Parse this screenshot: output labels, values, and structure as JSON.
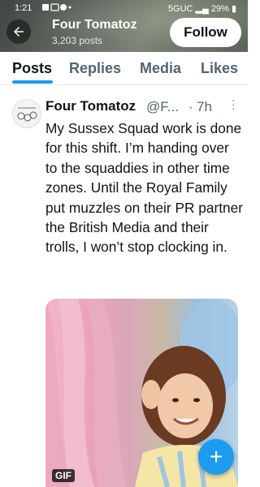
{
  "status_bar": {
    "time": "1:21",
    "network": "5GUC",
    "battery": "29%"
  },
  "profile": {
    "name": "Four Tomatoz",
    "post_count": "3,203 posts",
    "follow_label": "Follow"
  },
  "tabs": [
    {
      "label": "Posts",
      "active": true
    },
    {
      "label": "Replies",
      "active": false
    },
    {
      "label": "Media",
      "active": false
    },
    {
      "label": "Likes",
      "active": false
    }
  ],
  "post": {
    "author": "Four Tomatoz",
    "handle": "@F...",
    "separator": "·",
    "time": "7h",
    "text": "My Sussex Squad work is done for this shift. I’m handing over to the squaddies in other time zones. Until the Royal Family put muzzles on their PR partner the British Media and their trolls, I won’t stop clocking in.",
    "media_badge": "GIF"
  },
  "compose": {
    "icon": "plus-icon",
    "symbol": "+"
  },
  "colors": {
    "accent": "#1d9bf0",
    "text": "#0f1419",
    "muted": "#536471"
  }
}
